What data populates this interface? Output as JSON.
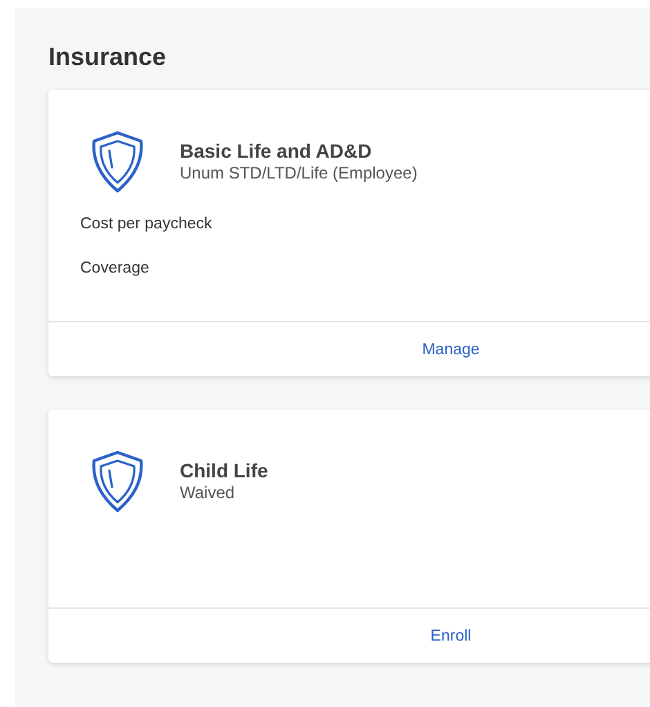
{
  "section": {
    "title": "Insurance"
  },
  "plans": [
    {
      "name": "Basic Life and AD&D",
      "subtitle": "Unum STD/LTD/Life (Employee)",
      "details": [
        "Cost per paycheck",
        "Coverage"
      ],
      "action": "Manage"
    },
    {
      "name": "Child Life",
      "subtitle": "Waived",
      "action": "Enroll"
    }
  ]
}
